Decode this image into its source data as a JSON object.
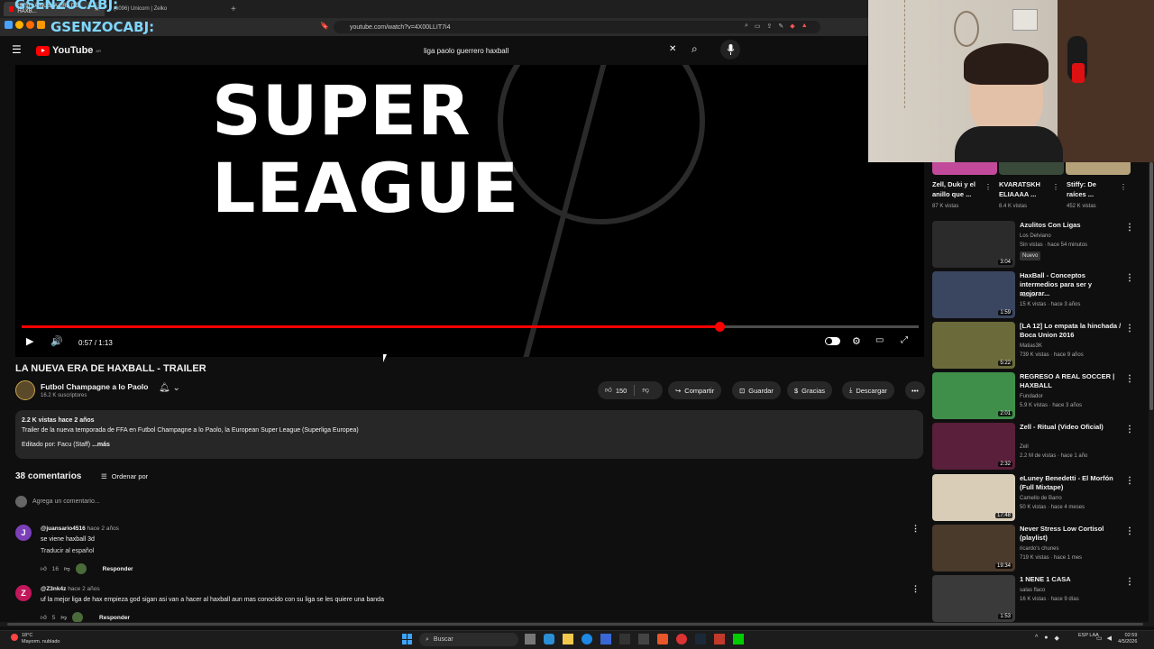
{
  "browser": {
    "tabs": [
      "(975) LA NUEVA ERA DE HAXB...",
      "(6096) Unicorn | Zelko"
    ],
    "url": "youtube.com/watch?v=4X00LLIT7i4",
    "overlay_text": "GSENZOCABJ:"
  },
  "header": {
    "logo": "YouTube",
    "country": "AR",
    "search_value": "liga paolo guerrero haxball"
  },
  "player": {
    "big_text_line1": "SUPER",
    "big_text_line2": "LEAGUE",
    "time": "0:57 / 1:13",
    "progress": 0.778
  },
  "video": {
    "title": "LA NUEVA ERA DE HAXBALL - TRAILER",
    "channel": "Futbol Champagne a lo Paolo",
    "subscribers": "16.2 K suscriptores",
    "likes": "150",
    "share": "Compartir",
    "save": "Guardar",
    "thanks": "Gracias",
    "download": "Descargar"
  },
  "description": {
    "stats": "2.2 K vistas  hace 2 años",
    "line1": "Trailer de la nueva temporada de FFA en Futbol Champagne a lo Paolo, la European Super League (Superliga Europea)",
    "line2": "Editado por: Facu (Staff)",
    "more": "...más"
  },
  "comments": {
    "count": "38 comentarios",
    "sort": "Ordenar por",
    "add_placeholder": "Agrega un comentario...",
    "items": [
      {
        "initial": "J",
        "author": "@juansario4516",
        "time": "hace 2 años",
        "text": "se viene haxball 3d",
        "translate": "Traducir al español",
        "likes": "16",
        "reply": "Responder",
        "color": "#7b3fb8"
      },
      {
        "initial": "Z",
        "author": "@Z3nk4z",
        "time": "hace 2 años",
        "text": "uf la mejor liga de hax empieza god sigan asi van a hacer al haxball aun mas conocido con su liga se les quiere una banda",
        "translate": "",
        "likes": "5",
        "reply": "Responder",
        "color": "#c2185b"
      }
    ]
  },
  "sidebar": {
    "top_cards": [
      {
        "title": "Zell, Duki y el anillo que ...",
        "views": "87 K vistas"
      },
      {
        "title": "KVARATSKH ELIAAAA ...",
        "views": "8.4 K vistas"
      },
      {
        "title": "Stiffy: De raíces ...",
        "views": "452 K vistas"
      }
    ],
    "items": [
      {
        "title": "Azulitos Con Ligas",
        "channel": "Los Delviano",
        "meta": "Sin vistas · hace 54 minutos",
        "badge": "Nuevo",
        "duration": "3:04",
        "thumb": "#2b2b2b"
      },
      {
        "title": "HaxBall - Conceptos intermedios para ser y mejorar...",
        "channel": "Yashin",
        "meta": "15 K vistas · hace 3 años",
        "badge": "",
        "duration": "1:59",
        "thumb": "#3a4560"
      },
      {
        "title": "[LA 12] Lo empata la hinchada / Boca Union 2016",
        "channel": "Matias3K",
        "meta": "739 K vistas · hace 9 años",
        "badge": "",
        "duration": "5:22",
        "thumb": "#6b6a3a"
      },
      {
        "title": "REGRESO A REAL SOCCER | HAXBALL",
        "channel": "Fundador",
        "meta": "5.9 K vistas · hace 3 años",
        "badge": "",
        "duration": "2:01",
        "thumb": "#3f8f4a"
      },
      {
        "title": "Zell - Ritual (Video Oficial)",
        "channel": "Zell",
        "meta": "2.2 M de vistas · hace 1 año",
        "badge": "",
        "duration": "2:32",
        "thumb": "#5a1f3a"
      },
      {
        "title": "eLuney Benedetti - El Morfón (Full Mixtape)",
        "channel": "Camello de Barro",
        "meta": "50 K vistas · hace 4 meses",
        "badge": "",
        "duration": "17:48",
        "thumb": "#d9cdb8"
      },
      {
        "title": "Never Stress Low Cortisol (playlist)",
        "channel": "ricardo's chunes",
        "meta": "719 K vistas · hace 1 mes",
        "badge": "",
        "duration": "19:34",
        "thumb": "#4a3a2c"
      },
      {
        "title": "1 NENE 1 CASA",
        "channel": "salas flaco",
        "meta": "16 K vistas · hace 9 días",
        "badge": "",
        "duration": "1:53",
        "thumb": "#3a3a3a"
      }
    ]
  },
  "taskbar": {
    "weather_temp": "18°C",
    "weather_desc": "Mayorm. nublado",
    "search": "Buscar",
    "lang": "ESP LAA",
    "time": "02:59",
    "date": "4/5/2026"
  }
}
